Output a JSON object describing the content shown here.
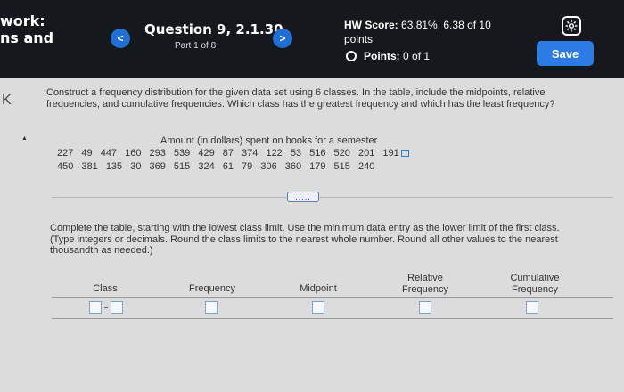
{
  "header": {
    "left_title_line1": "work:",
    "left_title_line2": "ns and",
    "prev_glyph": "<",
    "next_glyph": ">",
    "question_title": "Question 9, 2.1.30",
    "part": "Part 1 of 8",
    "hw_score_label": "HW Score:",
    "hw_score_value": "63.81%, 6.38 of 10",
    "hw_score_suffix": "points",
    "points_label": "Points:",
    "points_value": "0 of 1",
    "save_label": "Save",
    "icons": {
      "settings": "gear-icon",
      "radio": "radio-circle-icon"
    }
  },
  "question": {
    "back_glyph": "K",
    "text": "Construct a frequency distribution for the given data set using 6 classes. In the table, include the midpoints, relative frequencies, and cumulative frequencies. Which class has the greatest frequency and which has the least frequency?",
    "data_title": "Amount (in dollars) spent on books for a semester",
    "data_row1": "227 49 447 160 293 539 429 87 374 122 53 516 520 201 191",
    "data_row2": "450 381 135 30 369 515 324 61 79 306 360 179 515 240",
    "expand_label": "....."
  },
  "instructions": {
    "line1": "Complete the table, starting with the lowest class limit. Use the minimum data entry as the lower limit of the first class.",
    "line2": "(Type integers or decimals. Round the class limits to the nearest whole number. Round all other values to the nearest thousandth as needed.)"
  },
  "table": {
    "headers": {
      "class": "Class",
      "frequency": "Frequency",
      "midpoint": "Midpoint",
      "relative": "Relative Frequency",
      "cumulative": "Cumulative Frequency"
    }
  },
  "colors": {
    "header_bg": "#15181d",
    "accent": "#2c7be5",
    "page_bg": "#dcdcdc"
  }
}
